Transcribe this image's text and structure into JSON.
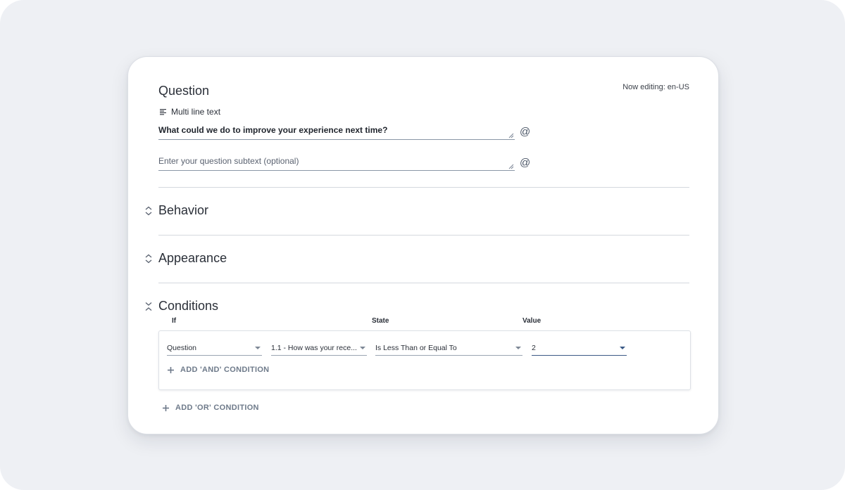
{
  "question": {
    "title": "Question",
    "now_editing": "Now editing: en-US",
    "type_label": "Multi line text",
    "text_value": "What could we do to improve your experience next time?",
    "subtext_placeholder": "Enter your question subtext (optional)",
    "at_symbol": "@"
  },
  "sections": {
    "behavior": "Behavior",
    "appearance": "Appearance",
    "conditions": "Conditions"
  },
  "conditions": {
    "headers": {
      "if": "If",
      "state": "State",
      "value": "Value"
    },
    "row": {
      "source": "Question",
      "question": "1.1 - How was your rece...",
      "state": "Is Less Than or Equal To",
      "value": "2"
    },
    "add_and": "ADD 'AND' CONDITION",
    "add_or": "ADD 'OR' CONDITION"
  },
  "colors": {
    "background": "#eef0f4",
    "accent": "#3b5a86",
    "muted_link": "#6e7a8a"
  },
  "icons": [
    "text-lines-icon",
    "resize-grip-icon",
    "expand-chevrons-icon",
    "collapse-chevrons-icon",
    "plus-icon"
  ]
}
